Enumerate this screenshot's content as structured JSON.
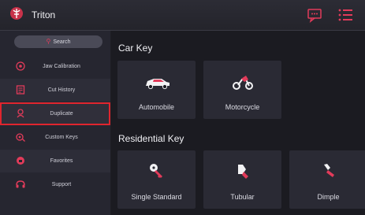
{
  "app": {
    "title": "Triton"
  },
  "sidebar": {
    "search_label": "Search",
    "items": [
      {
        "label": "Jaw Calibration",
        "icon": "target-icon"
      },
      {
        "label": "Cut History",
        "icon": "history-icon"
      },
      {
        "label": "Duplicate",
        "icon": "duplicate-key-icon"
      },
      {
        "label": "Custom Keys",
        "icon": "custom-keys-icon"
      },
      {
        "label": "Favorites",
        "icon": "favorites-icon"
      },
      {
        "label": "Support",
        "icon": "support-icon"
      }
    ],
    "selected_item": "Duplicate"
  },
  "main": {
    "car_key": {
      "title": "Car Key",
      "cards": [
        {
          "label": "Automobile",
          "icon": "car-icon"
        },
        {
          "label": "Motorcycle",
          "icon": "motorcycle-icon"
        }
      ]
    },
    "residential_key": {
      "title": "Residential Key",
      "cards": [
        {
          "label": "Single Standard",
          "icon": "standard-key-icon"
        },
        {
          "label": "Tubular",
          "icon": "tubular-key-icon"
        },
        {
          "label": "Dimple",
          "icon": "dimple-key-icon"
        }
      ]
    }
  },
  "colors": {
    "accent": "#e23b5a",
    "selection_outline": "#e0252e",
    "background": "#1e1e24"
  }
}
